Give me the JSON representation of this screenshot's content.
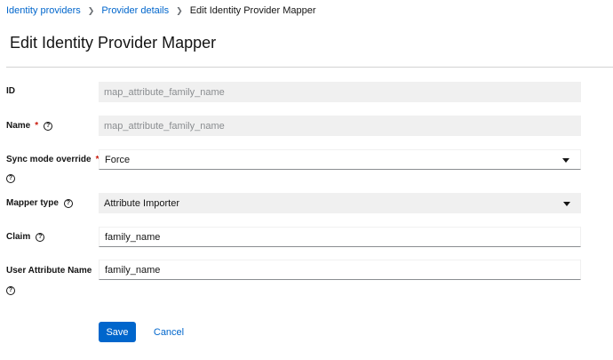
{
  "breadcrumb": {
    "items": [
      "Identity providers",
      "Provider details",
      "Edit Identity Provider Mapper"
    ]
  },
  "page_title": "Edit Identity Provider Mapper",
  "form": {
    "id": {
      "label": "ID",
      "value": "map_attribute_family_name"
    },
    "name": {
      "label": "Name",
      "required_mark": "*",
      "value": "map_attribute_family_name"
    },
    "sync_mode": {
      "label": "Sync mode override",
      "required_mark": "*",
      "value": "Force"
    },
    "mapper_type": {
      "label": "Mapper type",
      "value": "Attribute Importer"
    },
    "claim": {
      "label": "Claim",
      "value": "family_name"
    },
    "user_attribute": {
      "label": "User Attribute Name",
      "value": "family_name"
    }
  },
  "help_icon_glyph": "?",
  "actions": {
    "save_label": "Save",
    "cancel_label": "Cancel"
  },
  "colors": {
    "primary": "#0066cc",
    "required": "#c9190b",
    "readonly_bg": "#f0f0f0"
  }
}
